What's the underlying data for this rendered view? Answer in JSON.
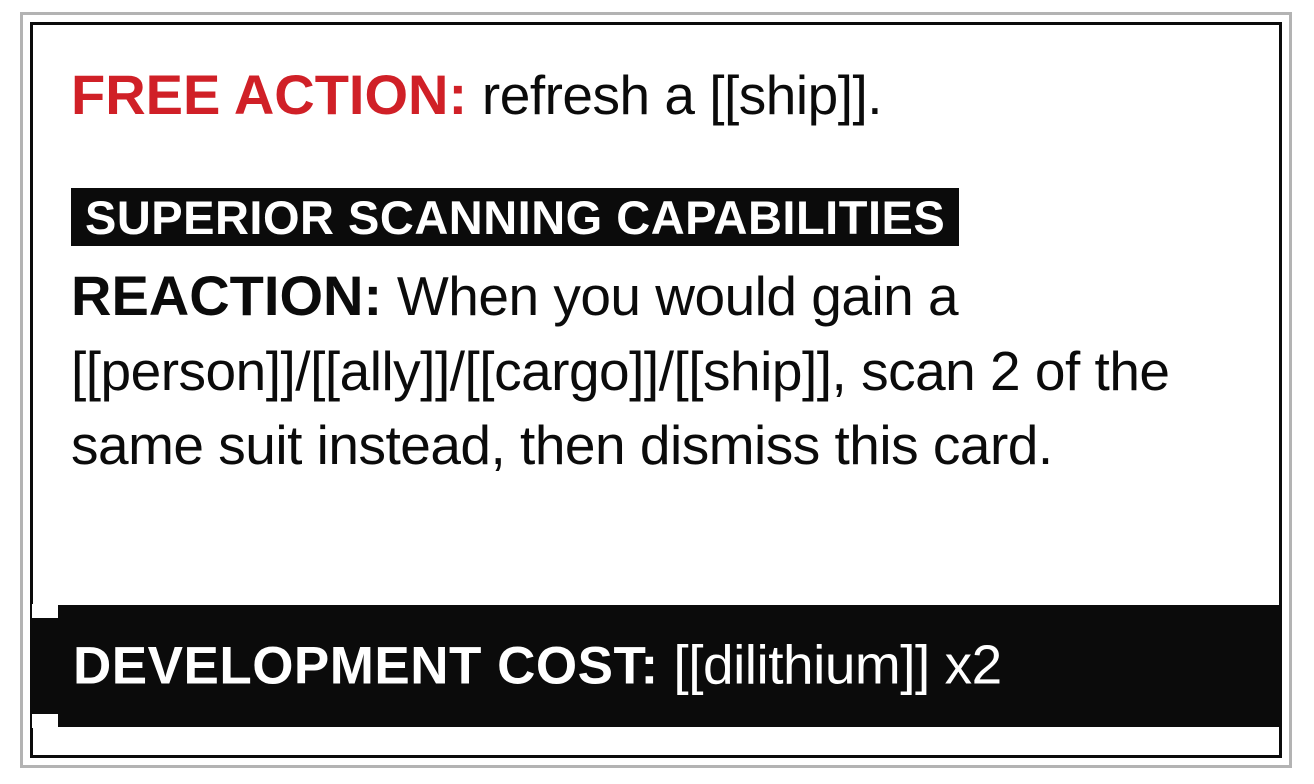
{
  "card": {
    "free_action_label": "FREE ACTION:",
    "free_action_text": " refresh a [[ship]].",
    "ability_name": "SUPERIOR SCANNING CAPABILITIES",
    "reaction_label": "REACTION:",
    "reaction_text": " When you would gain a [[person]]/[[ally]]/[[cargo]]/[[ship]], scan 2 of the same suit instead, then dismiss this card.",
    "dev_cost_label": "DEVELOPMENT COST:",
    "dev_cost_value": " [[dilithium]] x2"
  },
  "colors": {
    "accent_red": "#d02027",
    "ink": "#0b0b0b",
    "frame_grey": "#b3b3b3"
  }
}
